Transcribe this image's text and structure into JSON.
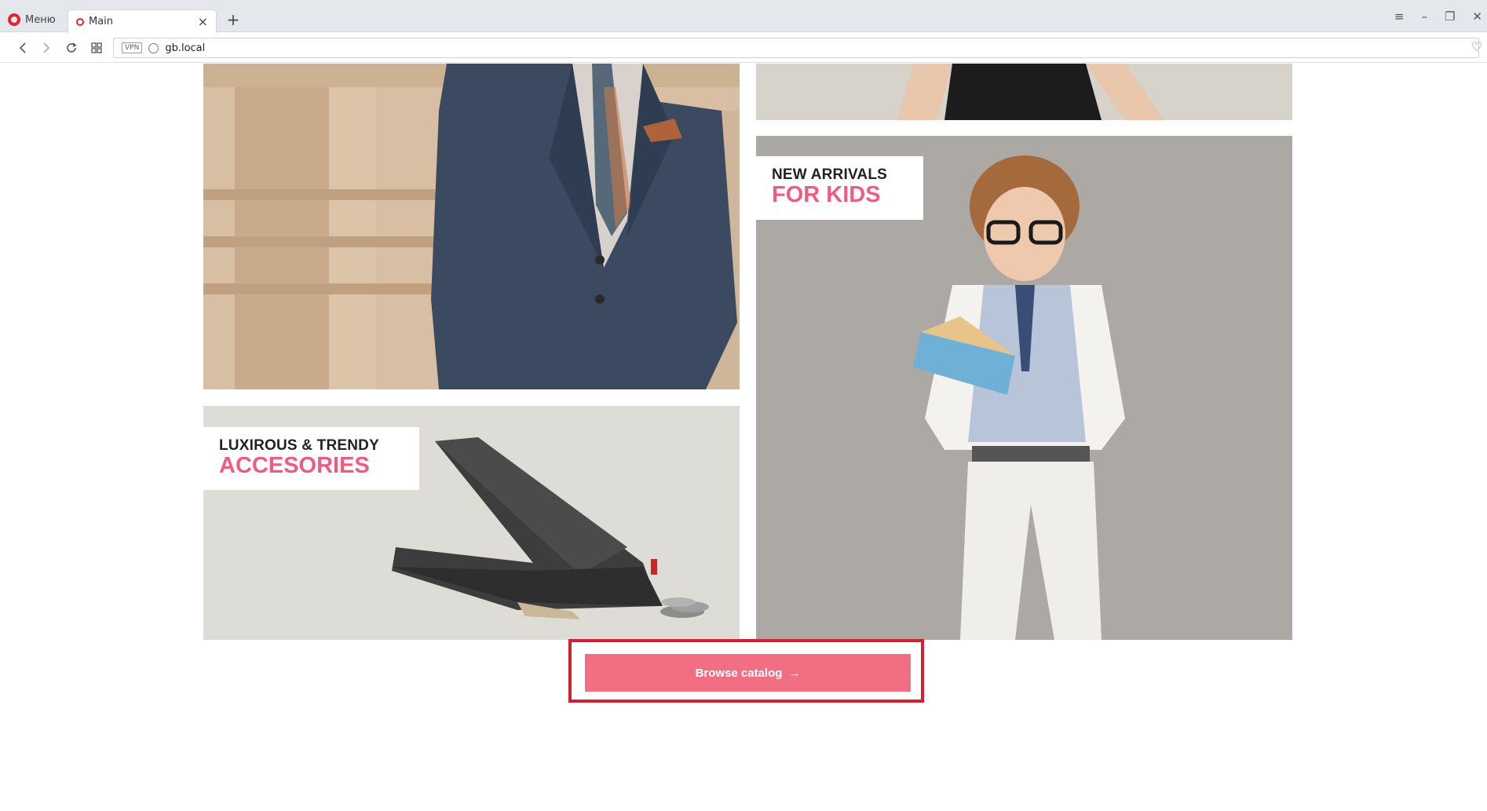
{
  "browser": {
    "menu_label": "Меню",
    "tab_title": "Main",
    "tab_close": "×",
    "new_tab": "+",
    "url": "gb.local",
    "vpn_label": "VPN",
    "controls": {
      "minimize": "–",
      "restore": "❐",
      "close": "✕",
      "tab_menu": "≡"
    }
  },
  "tiles": {
    "kids": {
      "line1": "NEW ARRIVALS",
      "line2": "FOR KIDS"
    },
    "accessories": {
      "line1": "LUXIROUS & TRENDY",
      "line2": "ACCESORIES"
    }
  },
  "cta": {
    "label": "Browse catalog",
    "arrow": "→"
  },
  "colors": {
    "accent_pink": "#ef5d7e",
    "button_pink": "#f26e82",
    "highlight_red": "#d32032"
  },
  "icons": {
    "back": "back-arrow-icon",
    "forward": "forward-arrow-icon",
    "reload": "reload-icon",
    "speed_dial": "grid-icon",
    "bookmark": "heart-icon"
  }
}
